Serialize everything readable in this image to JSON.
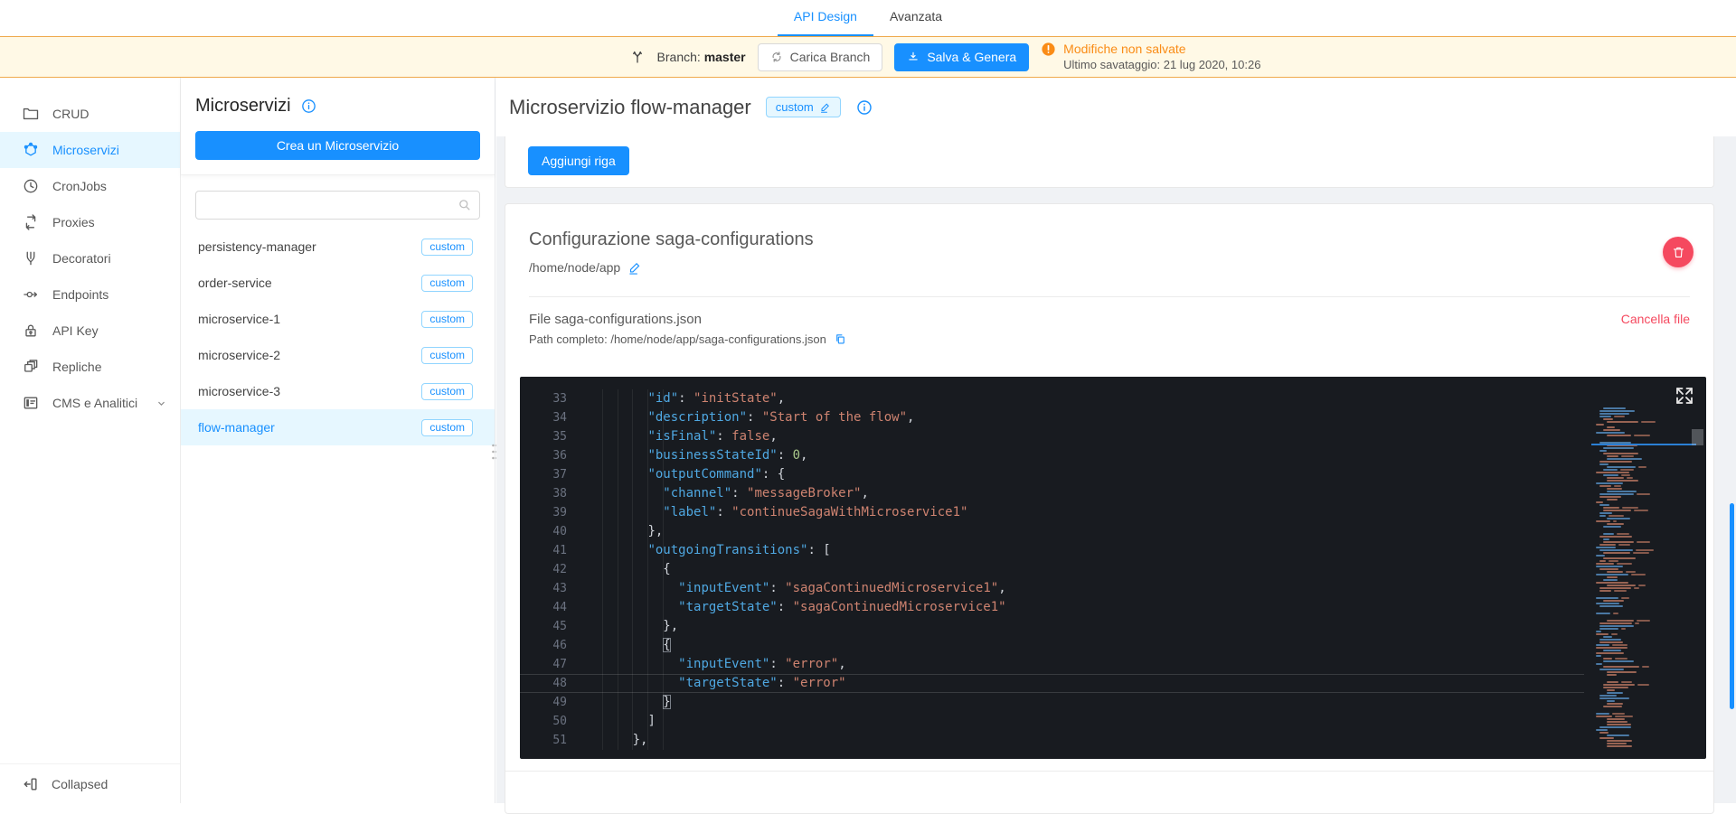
{
  "colors": {
    "accent": "#1890ff",
    "accent_light_bg": "#e6f7ff",
    "badge_border": "#91d5ff",
    "warning_orange": "#fa8c16",
    "danger_red": "#f5495f",
    "banner_bg": "#fff9e6",
    "editor_bg": "#181b20"
  },
  "tabs": [
    {
      "label": "API Design",
      "active": true
    },
    {
      "label": "Avanzata",
      "active": false
    }
  ],
  "banner": {
    "branch_label": "Branch:",
    "branch_name": "master",
    "load_branch_button": "Carica Branch",
    "save_button": "Salva & Genera",
    "unsaved_text": "Modifiche non salvate",
    "last_save_label": "Ultimo savataggio:",
    "last_save_value": "21 lug 2020, 10:26"
  },
  "sidebar": {
    "items": [
      {
        "label": "CRUD",
        "icon": "folder-icon",
        "active": false
      },
      {
        "label": "Microservizi",
        "icon": "microservices-icon",
        "active": true
      },
      {
        "label": "CronJobs",
        "icon": "clock-icon",
        "active": false
      },
      {
        "label": "Proxies",
        "icon": "proxy-loop-icon",
        "active": false
      },
      {
        "label": "Decoratori",
        "icon": "decorator-fork-icon",
        "active": false
      },
      {
        "label": "Endpoints",
        "icon": "endpoint-icon",
        "active": false
      },
      {
        "label": "API Key",
        "icon": "lock-icon",
        "active": false
      },
      {
        "label": "Repliche",
        "icon": "copies-icon",
        "active": false
      },
      {
        "label": "CMS e Analitici",
        "icon": "cms-icon",
        "active": false,
        "has_chevron": true
      }
    ],
    "collapse_label": "Collapsed"
  },
  "service_panel": {
    "title": "Microservizi",
    "create_button": "Crea un Microservizio",
    "search_value": "",
    "items": [
      {
        "name": "persistency-manager",
        "badge": "custom",
        "active": false
      },
      {
        "name": "order-service",
        "badge": "custom",
        "active": false
      },
      {
        "name": "microservice-1",
        "badge": "custom",
        "active": false
      },
      {
        "name": "microservice-2",
        "badge": "custom",
        "active": false
      },
      {
        "name": "microservice-3",
        "badge": "custom",
        "active": false
      },
      {
        "name": "flow-manager",
        "badge": "custom",
        "active": true
      }
    ]
  },
  "main": {
    "title": "Microservizio flow-manager",
    "title_badge": "custom",
    "add_row_button": "Aggiungi riga",
    "config": {
      "title": "Configurazione saga-configurations",
      "path": "/home/node/app",
      "file_label": "File saga-configurations.json",
      "full_path_label": "Path completo:",
      "full_path": "/home/node/app/saga-configurations.json",
      "delete_file_link": "Cancella file"
    }
  },
  "editor": {
    "first_line": 33,
    "active_line": 48,
    "lines": [
      {
        "n": 33,
        "indent": 8,
        "tokens": [
          [
            "k",
            "id"
          ],
          [
            "p",
            ": "
          ],
          [
            "s",
            "initState"
          ],
          [
            "p",
            ","
          ]
        ]
      },
      {
        "n": 34,
        "indent": 8,
        "tokens": [
          [
            "k",
            "description"
          ],
          [
            "p",
            ": "
          ],
          [
            "s",
            "Start of the flow"
          ],
          [
            "p",
            ","
          ]
        ]
      },
      {
        "n": 35,
        "indent": 8,
        "tokens": [
          [
            "k",
            "isFinal"
          ],
          [
            "p",
            ": "
          ],
          [
            "b",
            "false"
          ],
          [
            "p",
            ","
          ]
        ]
      },
      {
        "n": 36,
        "indent": 8,
        "tokens": [
          [
            "k",
            "businessStateId"
          ],
          [
            "p",
            ": "
          ],
          [
            "n",
            "0"
          ],
          [
            "p",
            ","
          ]
        ]
      },
      {
        "n": 37,
        "indent": 8,
        "tokens": [
          [
            "k",
            "outputCommand"
          ],
          [
            "p",
            ": {"
          ]
        ]
      },
      {
        "n": 38,
        "indent": 10,
        "tokens": [
          [
            "k",
            "channel"
          ],
          [
            "p",
            ": "
          ],
          [
            "s",
            "messageBroker"
          ],
          [
            "p",
            ","
          ]
        ]
      },
      {
        "n": 39,
        "indent": 10,
        "tokens": [
          [
            "k",
            "label"
          ],
          [
            "p",
            ": "
          ],
          [
            "s",
            "continueSagaWithMicroservice1"
          ]
        ]
      },
      {
        "n": 40,
        "indent": 8,
        "tokens": [
          [
            "p",
            "},"
          ]
        ]
      },
      {
        "n": 41,
        "indent": 8,
        "tokens": [
          [
            "k",
            "outgoingTransitions"
          ],
          [
            "p",
            ": ["
          ]
        ]
      },
      {
        "n": 42,
        "indent": 10,
        "tokens": [
          [
            "p",
            "{"
          ]
        ]
      },
      {
        "n": 43,
        "indent": 12,
        "tokens": [
          [
            "k",
            "inputEvent"
          ],
          [
            "p",
            ": "
          ],
          [
            "s",
            "sagaContinuedMicroservice1"
          ],
          [
            "p",
            ","
          ]
        ]
      },
      {
        "n": 44,
        "indent": 12,
        "tokens": [
          [
            "k",
            "targetState"
          ],
          [
            "p",
            ": "
          ],
          [
            "s",
            "sagaContinuedMicroservice1"
          ]
        ]
      },
      {
        "n": 45,
        "indent": 10,
        "tokens": [
          [
            "p",
            "},"
          ]
        ]
      },
      {
        "n": 46,
        "indent": 10,
        "tokens": [
          [
            "pb",
            "{"
          ]
        ]
      },
      {
        "n": 47,
        "indent": 12,
        "tokens": [
          [
            "k",
            "inputEvent"
          ],
          [
            "p",
            ": "
          ],
          [
            "s",
            "error"
          ],
          [
            "p",
            ","
          ]
        ]
      },
      {
        "n": 48,
        "indent": 12,
        "tokens": [
          [
            "k",
            "targetState"
          ],
          [
            "p",
            ": "
          ],
          [
            "s",
            "error"
          ]
        ]
      },
      {
        "n": 49,
        "indent": 10,
        "tokens": [
          [
            "pb",
            "}"
          ]
        ]
      },
      {
        "n": 50,
        "indent": 8,
        "tokens": [
          [
            "p",
            "]"
          ]
        ]
      },
      {
        "n": 51,
        "indent": 6,
        "tokens": [
          [
            "p",
            "},"
          ]
        ]
      }
    ]
  }
}
